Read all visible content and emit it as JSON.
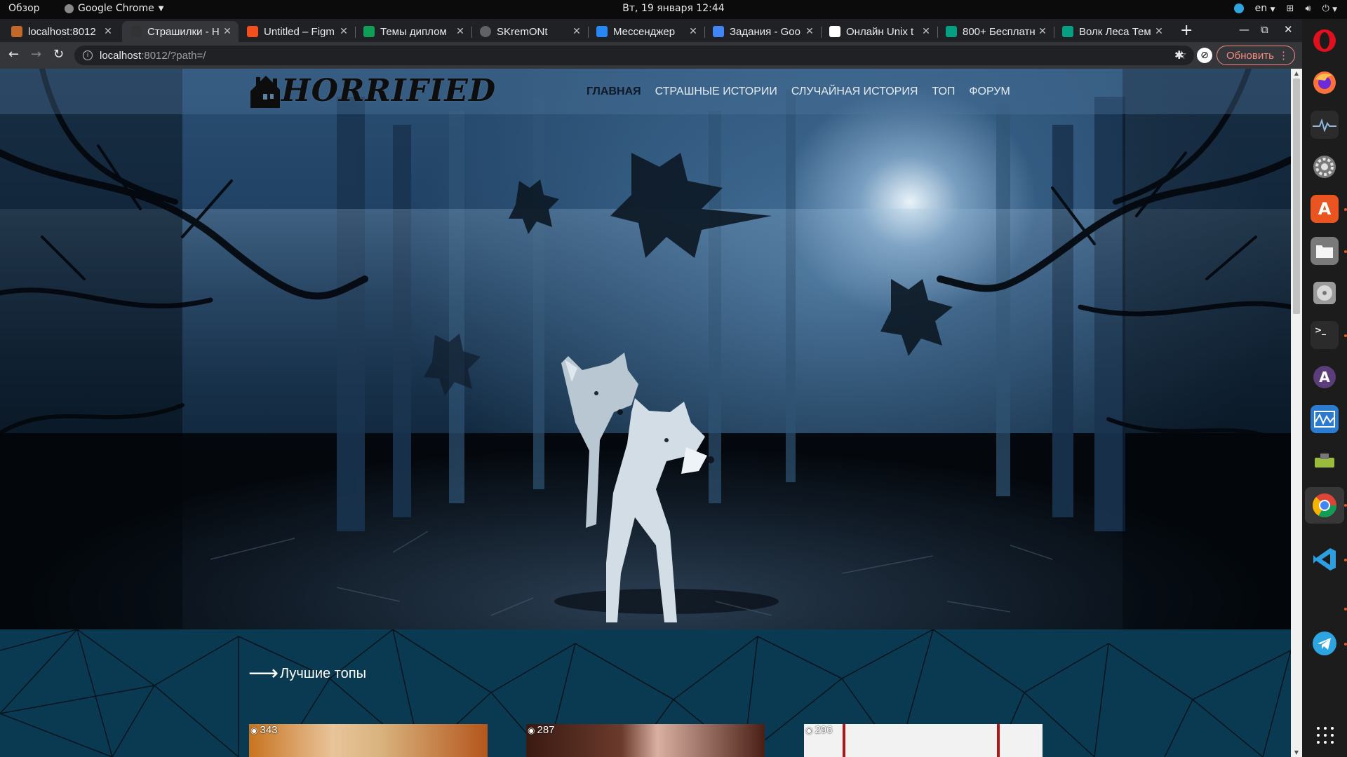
{
  "topbar": {
    "overview": "Обзор",
    "app_name": "Google Chrome",
    "clock": "Вт, 19 января  12:44",
    "lang": "en"
  },
  "tabs": [
    {
      "title": "localhost:8012",
      "fav_color": "#c0692a",
      "fav_icon": "horrified-icon",
      "active": false
    },
    {
      "title": "Страшилки - H",
      "fav_color": "#333333",
      "fav_icon": "horrified-icon",
      "active": true
    },
    {
      "title": "Untitled – Figm",
      "fav_color": "#f24e1e",
      "fav_icon": "figma-icon",
      "active": false
    },
    {
      "title": "Темы диплом",
      "fav_color": "#0f9d58",
      "fav_icon": "sheets-icon",
      "active": false
    },
    {
      "title": "SKremONt",
      "fav_color": "#5f6368",
      "fav_icon": "globe-icon",
      "active": false
    },
    {
      "title": "Мессенджер",
      "fav_color": "#2787f5",
      "fav_icon": "messenger-icon",
      "active": false
    },
    {
      "title": "Задания - Goo",
      "fav_color": "#4285f4",
      "fav_icon": "docs-icon",
      "active": false
    },
    {
      "title": "Онлайн Unix t",
      "fav_color": "#ffffff",
      "fav_icon": "chart-icon",
      "active": false
    },
    {
      "title": "800+ Бесплатн",
      "fav_color": "#05a081",
      "fav_icon": "pixabay-icon",
      "active": false
    },
    {
      "title": "Волк Леса Тем",
      "fav_color": "#05a081",
      "fav_icon": "pixabay-icon",
      "active": false
    }
  ],
  "toolbar": {
    "url_host": "localhost",
    "url_rest": ":8012/?path=/",
    "update_label": "Обновить"
  },
  "site": {
    "logo_text": "HORRIFIED",
    "menu": [
      "ГЛАВНАЯ",
      "СТРАШНЫЕ ИСТОРИИ",
      "СЛУЧАЙНАЯ ИСТОРИЯ",
      "ТОП",
      "ФОРУМ"
    ],
    "best_title": "Лучшие топы",
    "cards": [
      {
        "views": "343"
      },
      {
        "views": "287"
      },
      {
        "views": "296"
      }
    ]
  }
}
